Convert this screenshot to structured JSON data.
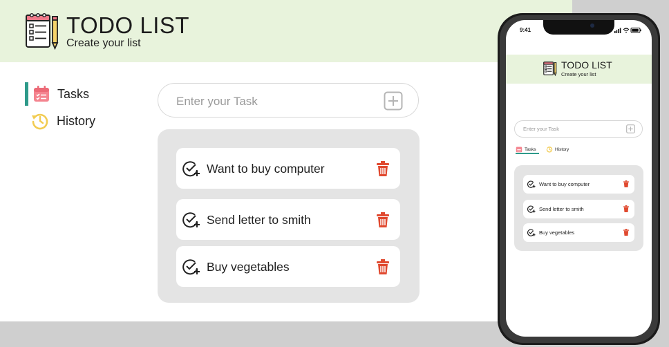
{
  "app": {
    "title": "TODO LIST",
    "subtitle": "Create your list"
  },
  "nav": [
    {
      "label": "Tasks",
      "icon": "calendar-icon",
      "active": true
    },
    {
      "label": "History",
      "icon": "history-icon",
      "active": false
    }
  ],
  "input": {
    "placeholder": "Enter your Task",
    "value": ""
  },
  "tasks": [
    {
      "text": "Want to buy computer"
    },
    {
      "text": "Send letter to smith"
    },
    {
      "text": "Buy vegetables"
    }
  ],
  "mobile": {
    "status_time": "9:41",
    "title": "TODO LIST",
    "subtitle": "Create your list",
    "placeholder": "Enter your Task",
    "tabs": [
      "Tasks",
      "History"
    ],
    "tasks": [
      "Want to buy computer",
      "Send letter to smith",
      "Buy vegetables"
    ]
  },
  "colors": {
    "header_bg": "#e8f3dc",
    "accent": "#2e9a8a",
    "delete": "#e0492f",
    "panel_bg": "#e4e4e4"
  }
}
